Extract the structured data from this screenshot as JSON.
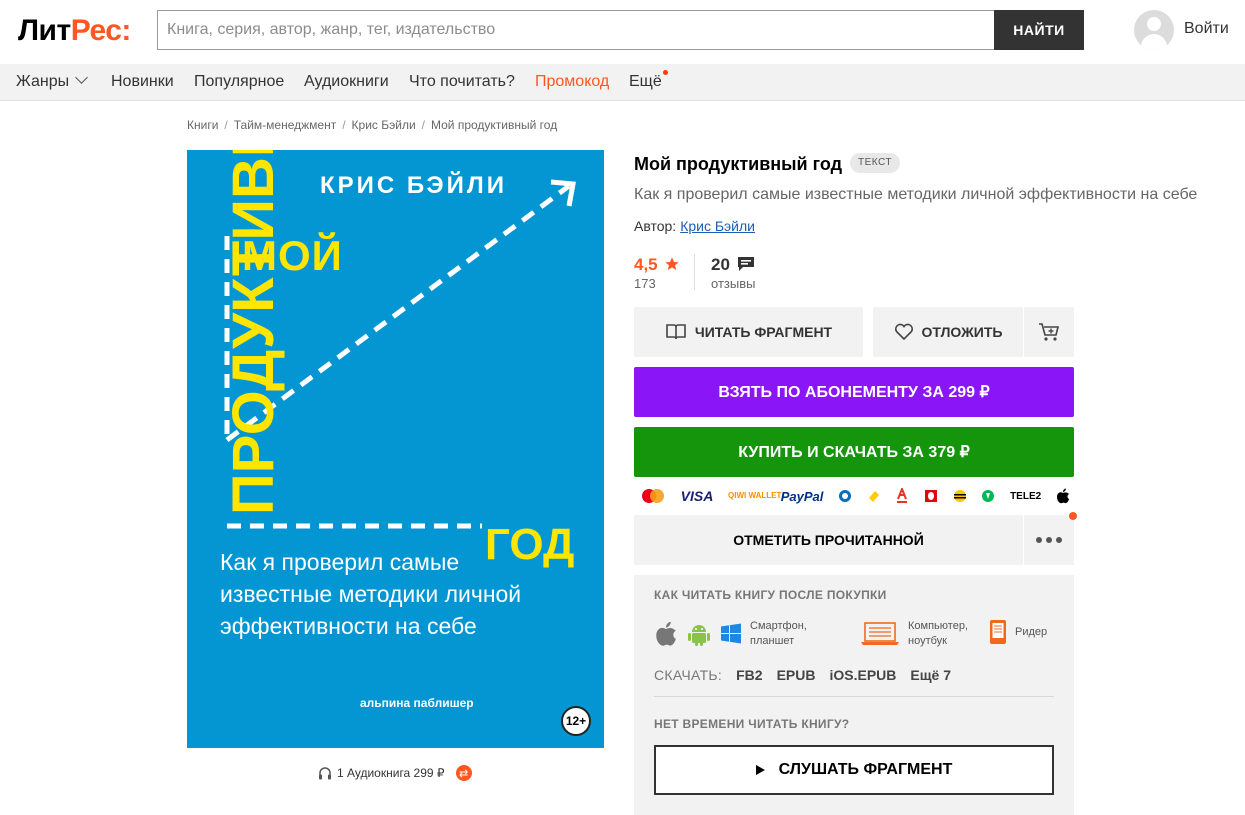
{
  "header": {
    "logo_part1": "Лит",
    "logo_part2": "Рес:",
    "search_placeholder": "Книга, серия, автор, жанр, тег, издательство",
    "search_button": "НАЙТИ",
    "login": "Войти"
  },
  "nav": {
    "genres": "Жанры",
    "new": "Новинки",
    "popular": "Популярное",
    "audiobooks": "Аудиокниги",
    "what_to_read": "Что почитать?",
    "promo": "Промокод",
    "more": "Ещё"
  },
  "breadcrumb": {
    "items": [
      "Книги",
      "Тайм-менеджмент",
      "Крис Бэйли",
      "Мой продуктивный год"
    ],
    "separator": "/"
  },
  "cover": {
    "author": "КРИС БЭЙЛИ",
    "title_word1": "МОЙ",
    "title_word2": "ПРОДУКТИВНЫЙ",
    "title_word3": "ГОД",
    "subtitle": "Как я проверил самые известные методики личной эффективности на себе",
    "publisher": "альпина паблишер",
    "age": "12+",
    "bg_color": "#0496d3",
    "accent_color": "#ffe500"
  },
  "audio_link": {
    "icon": "headphones-icon",
    "text": "1 Аудиокнига 299 ₽"
  },
  "book": {
    "title": "Мой продуктивный год",
    "type_badge": "ТЕКСТ",
    "subtitle": "Как я проверил самые известные методики личной эффективности на себе",
    "author_label": "Автор:",
    "author_name": "Крис Бэйли",
    "rating": "4,5",
    "rating_count": "173",
    "reviews": "20",
    "reviews_label": "отзывы"
  },
  "actions": {
    "read_fragment": "ЧИТАТЬ ФРАГМЕНТ",
    "save": "ОТЛОЖИТЬ",
    "subscribe": "ВЗЯТЬ ПО АБОНЕМЕНТУ ЗА 299 ₽",
    "buy": "КУПИТЬ И СКАЧАТЬ ЗА 379 ₽",
    "mark_read": "ОТМЕТИТЬ ПРОЧИТАННОЙ",
    "subscribe_color": "#8a15f7",
    "buy_color": "#14950c"
  },
  "payments": {
    "visa": "VISA",
    "qiwi": "QIWI WALLET",
    "paypal": "PayPal",
    "tele2": "TELE2"
  },
  "howto": {
    "title": "КАК ЧИТАТЬ КНИГУ ПОСЛЕ ПОКУПКИ",
    "phone_label_1": "Смартфон,",
    "phone_label_2": "планшет",
    "pc_label_1": "Компьютер,",
    "pc_label_2": "ноутбук",
    "reader_label": "Ридер",
    "download_label": "СКАЧАТЬ:",
    "formats": [
      "FB2",
      "EPUB",
      "iOS.EPUB",
      "Ещё 7"
    ],
    "no_time": "НЕТ ВРЕМЕНИ ЧИТАТЬ КНИГУ?",
    "listen": "СЛУШАТЬ ФРАГМЕНТ"
  }
}
